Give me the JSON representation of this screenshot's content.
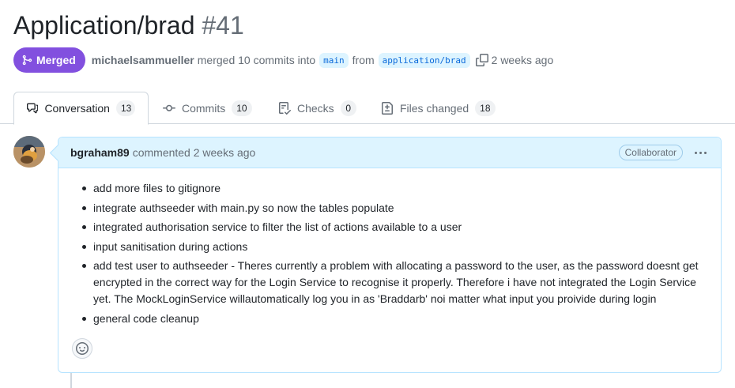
{
  "pr": {
    "title": "Application/brad",
    "number": "#41",
    "state_label": "Merged",
    "author": "michaelsammueller",
    "action_text": "merged 10 commits into",
    "base_branch": "main",
    "from_text": "from",
    "head_branch": "application/brad",
    "time_ago": "2 weeks ago",
    "icons": {
      "state": "git-merge-icon",
      "copy": "copy-icon"
    },
    "colors": {
      "merged": "#8250df",
      "branch_text": "#0969da",
      "branch_bg": "#ddf4ff"
    }
  },
  "tabs": [
    {
      "label": "Conversation",
      "count": "13",
      "icon": "comment-discussion-icon",
      "active": true
    },
    {
      "label": "Commits",
      "count": "10",
      "icon": "git-commit-icon",
      "active": false
    },
    {
      "label": "Checks",
      "count": "0",
      "icon": "checklist-icon",
      "active": false
    },
    {
      "label": "Files changed",
      "count": "18",
      "icon": "file-diff-icon",
      "active": false
    }
  ],
  "comment": {
    "author": "bgraham89",
    "meta": "commented 2 weeks ago",
    "role": "Collaborator",
    "items": [
      "add more files to gitignore",
      "integrate authseeder with main.py so now the tables populate",
      "integrated authorisation service to filter the list of actions available to a user",
      "input sanitisation during actions",
      "add test user to authseeder - Theres currently a problem with allocating a password to the user, as the password doesnt get encrypted in the correct way for the Login Service to recognise it properly. Therefore i have not integrated the Login Service yet. The MockLoginService willautomatically log you in as 'Braddarb' noi matter what input you proivide during login",
      "general code cleanup"
    ],
    "colors": {
      "header_bg": "#ddf4ff",
      "border": "#b6e3ff"
    }
  }
}
